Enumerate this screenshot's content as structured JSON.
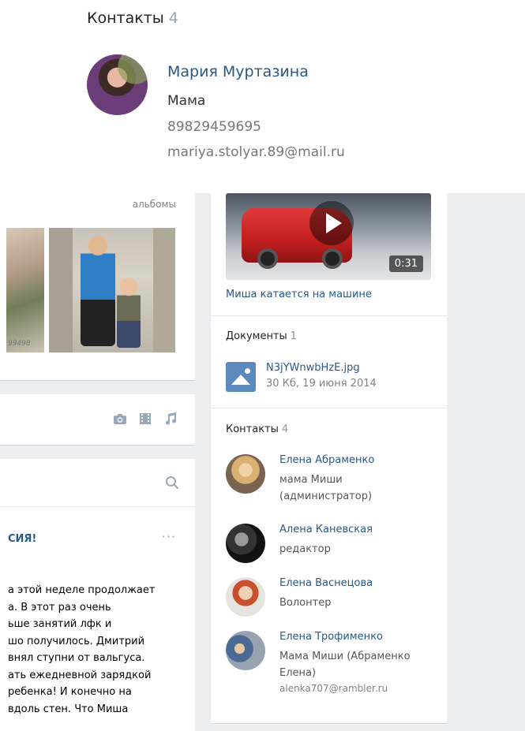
{
  "top_card": {
    "header_title": "Контакты",
    "header_count": "4",
    "contact": {
      "name": "Мария Муртазина",
      "role": "Мама",
      "phone": "89829459695",
      "email": "mariya.stolyar.89@mail.ru"
    }
  },
  "left": {
    "albums_label": "альбомы",
    "photo1_caption": "99498",
    "media_icons": [
      "camera-icon",
      "video-icon",
      "music-icon"
    ],
    "post": {
      "title": "СИЯ!",
      "more": "···",
      "text_lines": [
        "а этой неделе продолжает",
        "а. В этот раз очень",
        "ьше занятий лфк и",
        "шо получилось. Дмитрий",
        "внял ступни от вальгуса.",
        "ать ежедневной зарядкой",
        "ребенка! И конечно на",
        "вдоль стен. Что Миша"
      ]
    }
  },
  "right": {
    "video": {
      "duration": "0:31",
      "title": "Миша катается на машине"
    },
    "documents": {
      "title": "Документы",
      "count": "1",
      "file_name": "N3jYWnwbHzE.jpg",
      "file_meta": "30 Кб, 19 июня 2014"
    },
    "contacts": {
      "title": "Контакты",
      "count": "4",
      "items": [
        {
          "name": "Елена Абраменко",
          "desc": "мама Миши\n(администратор)",
          "email": ""
        },
        {
          "name": "Алена Каневская",
          "desc": "редактор",
          "email": ""
        },
        {
          "name": "Елена Васнецова",
          "desc": "Волонтер",
          "email": ""
        },
        {
          "name": "Елена Трофименко",
          "desc": "Мама Миши (Абраменко\nЕлена)",
          "email": "alenka707@rambler.ru"
        }
      ]
    }
  },
  "colors": {
    "link": "#2a5885",
    "muted": "#828282",
    "page_bg": "#edeef0",
    "doc_icon": "#5b88bd"
  }
}
